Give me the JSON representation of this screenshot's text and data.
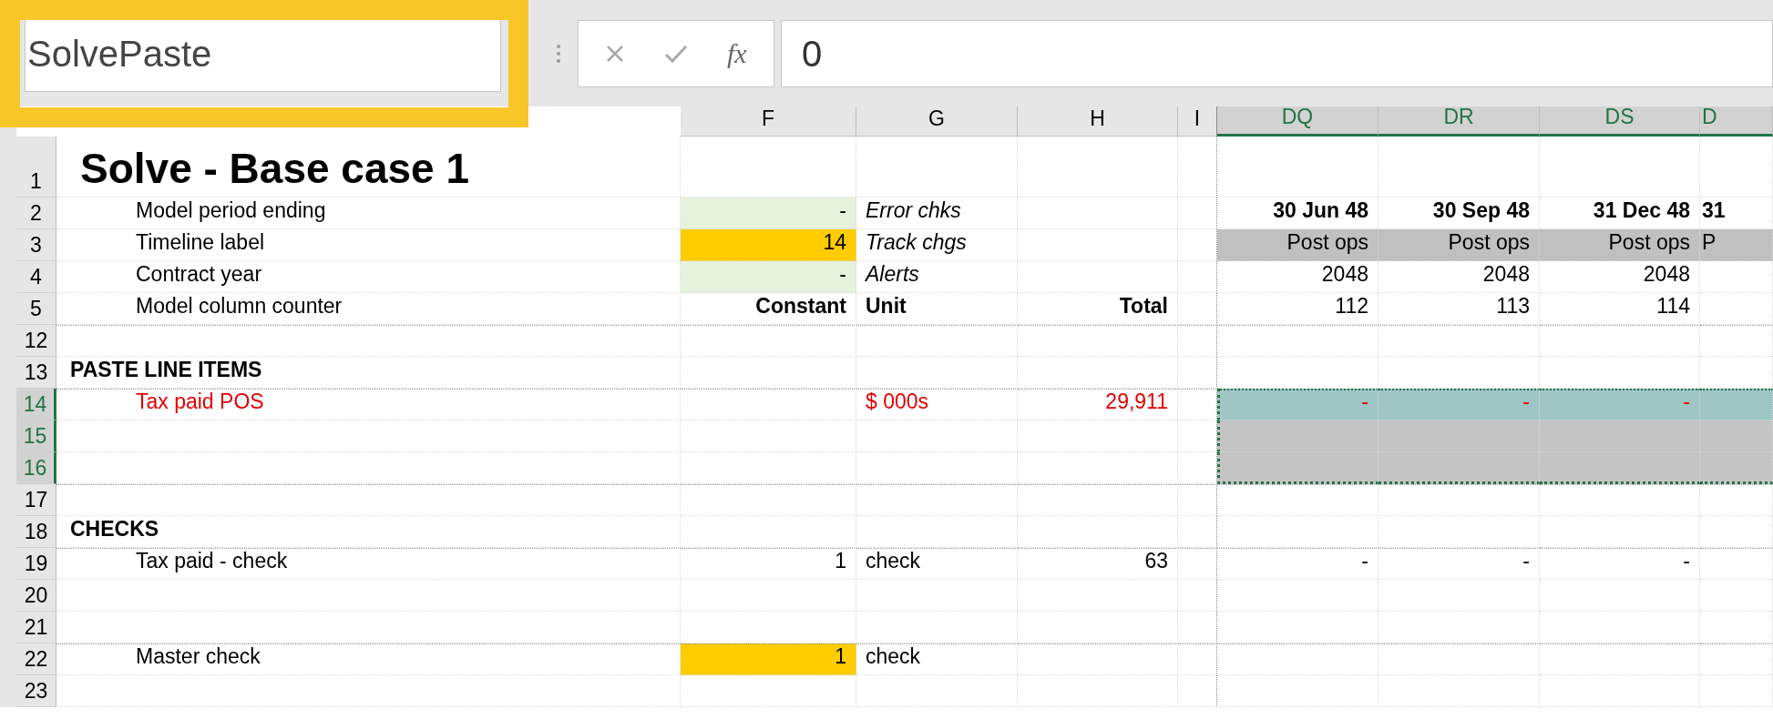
{
  "formula_bar": {
    "name_box": "SolvePaste",
    "function_label": "fx",
    "value": "0"
  },
  "columns": [
    {
      "label": "F",
      "selected": false
    },
    {
      "label": "G",
      "selected": false
    },
    {
      "label": "H",
      "selected": false
    },
    {
      "label": "I",
      "selected": false
    },
    {
      "label": "DQ",
      "selected": true
    },
    {
      "label": "DR",
      "selected": true
    },
    {
      "label": "DS",
      "selected": true
    },
    {
      "label": "D",
      "selected": true
    }
  ],
  "rows": [
    {
      "number": "1",
      "kind": "title",
      "selected": false,
      "label": "Solve - Base case 1"
    },
    {
      "number": "2",
      "kind": "dates",
      "selected": false,
      "label": "Model period ending",
      "constant": {
        "text": "-",
        "color": "#e6f2dc"
      },
      "unit": "Error chks",
      "periods": [
        "30 Jun 48",
        "30 Sep 48",
        "31 Dec 48",
        "31"
      ]
    },
    {
      "number": "3",
      "kind": "phase",
      "selected": false,
      "label": "Timeline label",
      "constant": {
        "text": "14",
        "color": "#ffcc00"
      },
      "unit": "Track chgs",
      "periods": [
        "Post ops",
        "Post ops",
        "Post ops",
        "P"
      ]
    },
    {
      "number": "4",
      "kind": "years",
      "selected": false,
      "label": "Contract year",
      "constant": {
        "text": "-",
        "color": "#e6f2dc"
      },
      "unit": "Alerts",
      "periods": [
        "2048",
        "2048",
        "2048"
      ]
    },
    {
      "number": "5",
      "kind": "counter",
      "selected": false,
      "label": "Model column counter",
      "constant": {
        "text": "Constant"
      },
      "unit": "Unit",
      "total": "Total",
      "periods": [
        "112",
        "113",
        "114"
      ]
    },
    {
      "number": "12",
      "kind": "blank",
      "selected": false
    },
    {
      "number": "13",
      "kind": "section",
      "selected": false,
      "label": "PASTE LINE ITEMS"
    },
    {
      "number": "14",
      "kind": "paste_item",
      "selected": true,
      "label": "Tax paid POS",
      "unit": "$ 000s",
      "total": "29,911",
      "periods": [
        "-",
        "-",
        "-"
      ]
    },
    {
      "number": "15",
      "kind": "blank",
      "selected": true
    },
    {
      "number": "16",
      "kind": "blank",
      "selected": true
    },
    {
      "number": "17",
      "kind": "blank",
      "selected": false
    },
    {
      "number": "18",
      "kind": "section",
      "selected": false,
      "label": "CHECKS"
    },
    {
      "number": "19",
      "kind": "item",
      "selected": false,
      "label": "Tax paid - check",
      "constant": {
        "text": "1"
      },
      "unit": "check",
      "total": "63",
      "periods": [
        "-",
        "-",
        "-"
      ]
    },
    {
      "number": "20",
      "kind": "blank",
      "selected": false
    },
    {
      "number": "21",
      "kind": "blank",
      "selected": false
    },
    {
      "number": "22",
      "kind": "item",
      "selected": false,
      "label": "Master check",
      "constant": {
        "text": "1",
        "color": "#ffcc00"
      },
      "unit": "check"
    },
    {
      "number": "23",
      "kind": "blank",
      "selected": false
    }
  ]
}
